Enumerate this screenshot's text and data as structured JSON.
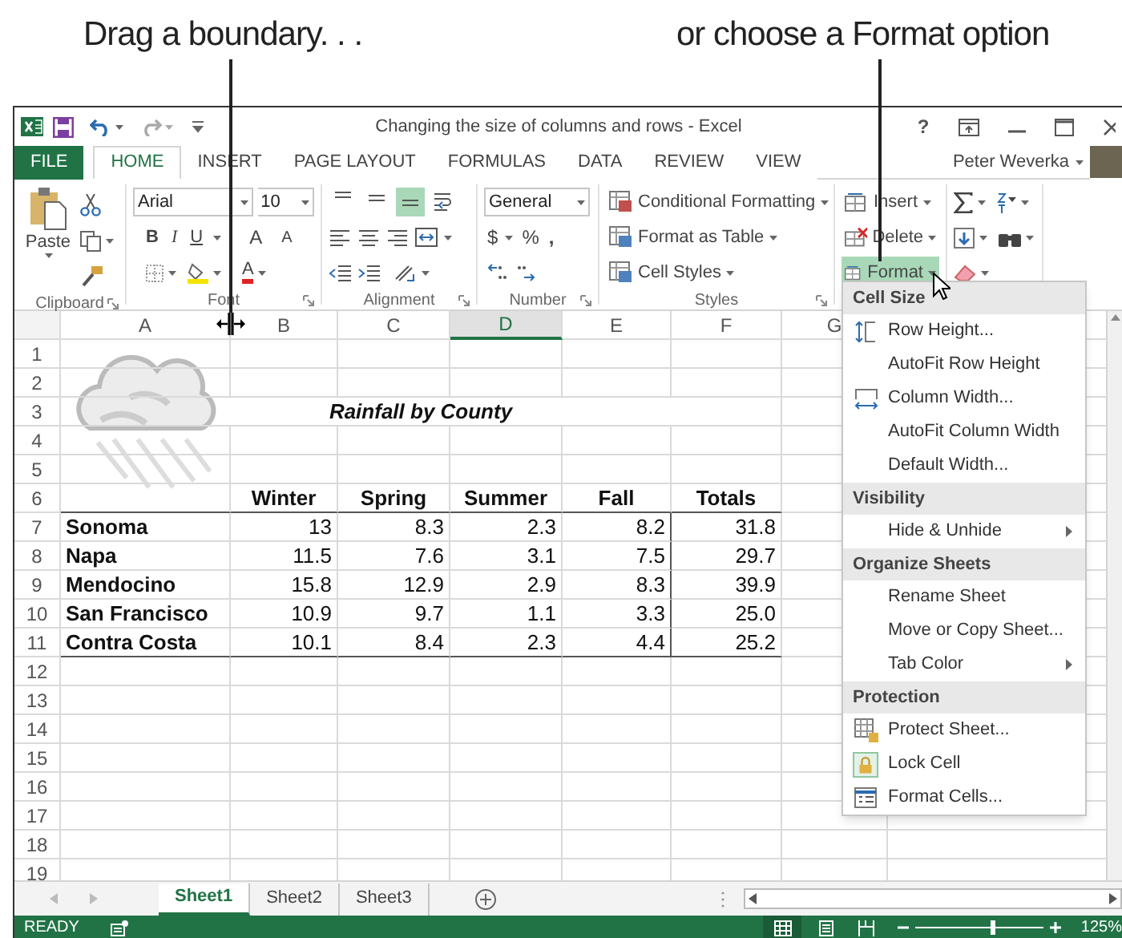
{
  "callouts": [
    {
      "text": "Drag a boundary. . ."
    },
    {
      "text": "or choose a Format option"
    }
  ],
  "window": {
    "title": "Changing the size of columns and rows - Excel",
    "help": "?"
  },
  "ribbon_tabs": [
    {
      "label": "FILE",
      "kind": "file",
      "selected": false
    },
    {
      "label": "HOME",
      "kind": "tab",
      "selected": true
    },
    {
      "label": "INSERT",
      "kind": "tab",
      "selected": false
    },
    {
      "label": "PAGE LAYOUT",
      "kind": "tab",
      "selected": false
    },
    {
      "label": "FORMULAS",
      "kind": "tab",
      "selected": false
    },
    {
      "label": "DATA",
      "kind": "tab",
      "selected": false
    },
    {
      "label": "REVIEW",
      "kind": "tab",
      "selected": false
    },
    {
      "label": "VIEW",
      "kind": "tab",
      "selected": false
    }
  ],
  "user": {
    "name": "Peter Weverka"
  },
  "ribbon": {
    "clipboard": {
      "paste": "Paste",
      "group": "Clipboard"
    },
    "font": {
      "name": "Arial",
      "size": "10",
      "bold": "B",
      "italic": "I",
      "underline": "U",
      "grow": "A",
      "shrink": "A",
      "font_color": "A",
      "group": "Font"
    },
    "alignment": {
      "group": "Alignment",
      "vertical_align": [
        {
          "selected": false
        },
        {
          "selected": false
        },
        {
          "selected": true
        }
      ]
    },
    "number": {
      "format": "General",
      "currency": "$",
      "percent": "%",
      "comma": ",",
      "group": "Number"
    },
    "styles": {
      "group": "Styles",
      "commands": [
        "Conditional Formatting",
        "Format as Table",
        "Cell Styles"
      ]
    },
    "cells": {
      "commands": [
        {
          "label": "Insert",
          "selected": false
        },
        {
          "label": "Delete",
          "selected": false
        },
        {
          "label": "Format",
          "selected": true
        }
      ]
    }
  },
  "format_menu": {
    "sections": [
      {
        "heading": "Cell Size",
        "items": [
          {
            "label": "Row Height...",
            "submenu": false,
            "checked": false
          },
          {
            "label": "AutoFit Row Height",
            "submenu": false,
            "checked": false
          },
          {
            "label": "Column Width...",
            "submenu": false,
            "checked": false
          },
          {
            "label": "AutoFit Column Width",
            "submenu": false,
            "checked": false
          },
          {
            "label": "Default Width...",
            "submenu": false,
            "checked": false
          }
        ]
      },
      {
        "heading": "Visibility",
        "items": [
          {
            "label": "Hide & Unhide",
            "submenu": true,
            "checked": false
          }
        ]
      },
      {
        "heading": "Organize Sheets",
        "items": [
          {
            "label": "Rename Sheet",
            "submenu": false,
            "checked": false
          },
          {
            "label": "Move or Copy Sheet...",
            "submenu": false,
            "checked": false
          },
          {
            "label": "Tab Color",
            "submenu": true,
            "checked": false
          }
        ]
      },
      {
        "heading": "Protection",
        "items": [
          {
            "label": "Protect Sheet...",
            "submenu": false,
            "checked": false
          },
          {
            "label": "Lock Cell",
            "submenu": false,
            "checked": true
          },
          {
            "label": "Format Cells...",
            "submenu": false,
            "checked": false
          }
        ]
      }
    ]
  },
  "sheet": {
    "columns": [
      {
        "label": "A",
        "selected": false
      },
      {
        "label": "B",
        "selected": false
      },
      {
        "label": "C",
        "selected": false
      },
      {
        "label": "D",
        "selected": true
      },
      {
        "label": "E",
        "selected": false
      },
      {
        "label": "F",
        "selected": false
      },
      {
        "label": "G",
        "selected": false
      }
    ],
    "row_numbers": [
      "1",
      "2",
      "3",
      "4",
      "5",
      "6",
      "7",
      "8",
      "9",
      "10",
      "11",
      "12",
      "13",
      "14",
      "15",
      "16",
      "17",
      "18",
      "19"
    ],
    "title": "Rainfall by County",
    "headers": [
      "Winter",
      "Spring",
      "Summer",
      "Fall",
      "Totals"
    ],
    "rows": [
      {
        "name": "Sonoma",
        "values": [
          "13",
          "8.3",
          "2.3",
          "8.2",
          "31.8"
        ]
      },
      {
        "name": "Napa",
        "values": [
          "11.5",
          "7.6",
          "3.1",
          "7.5",
          "29.7"
        ]
      },
      {
        "name": "Mendocino",
        "values": [
          "15.8",
          "12.9",
          "2.9",
          "8.3",
          "39.9"
        ]
      },
      {
        "name": "San Francisco",
        "values": [
          "10.9",
          "9.7",
          "1.1",
          "3.3",
          "25.0"
        ]
      },
      {
        "name": "Contra Costa",
        "values": [
          "10.1",
          "8.4",
          "2.3",
          "4.4",
          "25.2"
        ]
      }
    ]
  },
  "sheet_tabs": [
    {
      "label": "Sheet1",
      "selected": true
    },
    {
      "label": "Sheet2",
      "selected": false
    },
    {
      "label": "Sheet3",
      "selected": false
    }
  ],
  "status_bar": {
    "mode": "READY",
    "zoom": "125%",
    "zoom_slider": {
      "level": 0.6
    }
  }
}
